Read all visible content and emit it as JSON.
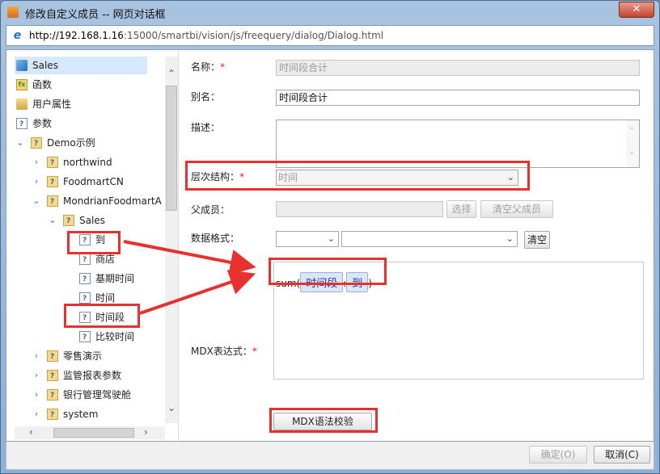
{
  "window": {
    "title": "修改自定义成员 -- 网页对话框",
    "close_label": "✕",
    "url_host": "http://192.168.1.16",
    "url_rest": ":15000/smartbi/vision/js/freequery/dialog/Dialog.html"
  },
  "tree": {
    "items": [
      {
        "label": "Sales",
        "icon": "cube-icon"
      },
      {
        "label": "函数",
        "icon": "function-icon"
      },
      {
        "label": "用户属性",
        "icon": "user-property-icon"
      },
      {
        "label": "参数",
        "icon": "parameter-icon"
      },
      {
        "label": "Demo示例",
        "icon": "folder-icon"
      },
      {
        "label": "northwind",
        "icon": "folder-icon"
      },
      {
        "label": "FoodmartCN",
        "icon": "folder-icon"
      },
      {
        "label": "MondrianFoodmartA",
        "icon": "folder-icon"
      },
      {
        "label": "Sales",
        "icon": "folder-icon"
      },
      {
        "label": "到",
        "icon": "parameter-icon"
      },
      {
        "label": "商店",
        "icon": "parameter-icon"
      },
      {
        "label": "基期时间",
        "icon": "parameter-icon"
      },
      {
        "label": "时间",
        "icon": "parameter-icon"
      },
      {
        "label": "时间段",
        "icon": "parameter-icon"
      },
      {
        "label": "比较时间",
        "icon": "parameter-icon"
      },
      {
        "label": "零售演示",
        "icon": "folder-icon"
      },
      {
        "label": "监管报表参数",
        "icon": "folder-icon"
      },
      {
        "label": "银行管理驾驶舱",
        "icon": "folder-icon"
      },
      {
        "label": "system",
        "icon": "folder-icon"
      }
    ]
  },
  "form": {
    "name_label": "名称：",
    "name_value": "时间段合计",
    "alias_label": "别名：",
    "alias_value": "时间段合计",
    "desc_label": "描述：",
    "hierarchy_label": "层次结构：",
    "hierarchy_value": "时间",
    "parent_label": "父成员：",
    "select_label": "选择",
    "clear_parent_label": "清空父成员",
    "format_label": "数据格式：",
    "clear_label": "清空",
    "mdx_label": "MDX表达式：",
    "mdx_prefix": "sum(",
    "mdx_chip1": "时间段",
    "mdx_sep": ":",
    "mdx_chip2": "到",
    "mdx_suffix": ")",
    "validate_label": "MDX语法校验",
    "required_mark": "*"
  },
  "footer": {
    "ok_label": "确定(O)",
    "cancel_label": "取消(C)"
  },
  "colors": {
    "highlight": "#e8312e",
    "chip_bg": "#dbe6fb"
  }
}
